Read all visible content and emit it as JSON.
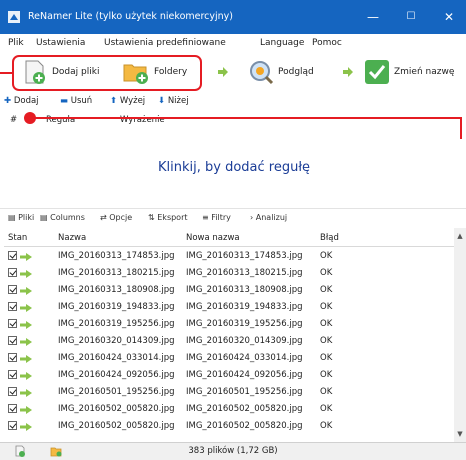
{
  "window": {
    "title": "ReNamer Lite (tylko użytek niekomercyjny)",
    "controls": {
      "minimize": "—",
      "maximize": "☐",
      "close": "✕"
    }
  },
  "menu": [
    "Plik",
    "Ustawienia",
    "Ustawienia predefiniowane",
    "Language",
    "Pomoc"
  ],
  "toolbar": {
    "add_files": "Dodaj pliki",
    "folders": "Foldery",
    "preview": "Podgląd",
    "rename": "Zmień nazwę"
  },
  "rules_toolbar": {
    "add": "Dodaj",
    "remove": "Usuń",
    "up": "Wyżej",
    "down": "Niżej"
  },
  "rules_table": {
    "columns": [
      "#",
      "Reguła",
      "Wyrażenie"
    ],
    "hint": "Klinkij, by dodać regułę"
  },
  "file_tabs": [
    "Pliki",
    "Columns",
    "Opcje",
    "Eksport",
    "Filtry",
    "Analizuj"
  ],
  "files_table": {
    "columns": [
      "Stan",
      "Nazwa",
      "Nowa nazwa",
      "Błąd"
    ],
    "rows": [
      {
        "name": "IMG_20160313_174853.jpg",
        "new_name": "IMG_20160313_174853.jpg",
        "error": "OK"
      },
      {
        "name": "IMG_20160313_180215.jpg",
        "new_name": "IMG_20160313_180215.jpg",
        "error": "OK"
      },
      {
        "name": "IMG_20160313_180908.jpg",
        "new_name": "IMG_20160313_180908.jpg",
        "error": "OK"
      },
      {
        "name": "IMG_20160319_194833.jpg",
        "new_name": "IMG_20160319_194833.jpg",
        "error": "OK"
      },
      {
        "name": "IMG_20160319_195256.jpg",
        "new_name": "IMG_20160319_195256.jpg",
        "error": "OK"
      },
      {
        "name": "IMG_20160320_014309.jpg",
        "new_name": "IMG_20160320_014309.jpg",
        "error": "OK"
      },
      {
        "name": "IMG_20160424_033014.jpg",
        "new_name": "IMG_20160424_033014.jpg",
        "error": "OK"
      },
      {
        "name": "IMG_20160424_092056.jpg",
        "new_name": "IMG_20160424_092056.jpg",
        "error": "OK"
      },
      {
        "name": "IMG_20160501_195256.jpg",
        "new_name": "IMG_20160501_195256.jpg",
        "error": "OK"
      },
      {
        "name": "IMG_20160502_005820.jpg",
        "new_name": "IMG_20160502_005820.jpg",
        "error": "OK"
      },
      {
        "name": "IMG_20160502_005820.jpg",
        "new_name": "IMG_20160502_005820.jpg",
        "error": "OK"
      }
    ]
  },
  "status": {
    "count": "383 plików (1,72 GB)"
  },
  "colors": {
    "titlebar": "#1565c0",
    "highlight": "#e51c23",
    "hint": "#1a3c96",
    "arrow": "#8bc34a"
  }
}
